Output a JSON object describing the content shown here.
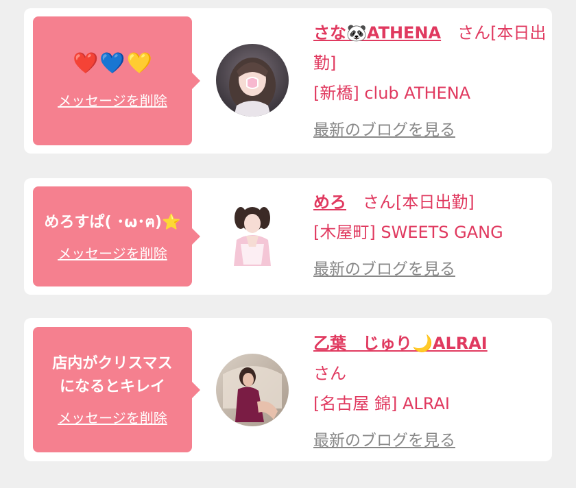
{
  "favorites": [
    {
      "hearts": [
        "❤️",
        "💙",
        "💛"
      ],
      "message": "",
      "delete_label": "メッセージを削除",
      "name": "さな🐼ATHENA",
      "san_status": "　さん[本日出勤]",
      "shop": "[新橋] club ATHENA",
      "blog_label": "最新のブログを見る"
    },
    {
      "hearts": [],
      "message": "めろすぱ( ･ω･ฅ)⭐️",
      "delete_label": "メッセージを削除",
      "name": "めろ",
      "san_status": "　さん[本日出勤]",
      "shop": "[木屋町] SWEETS GANG",
      "blog_label": "最新のブログを見る"
    },
    {
      "hearts": [],
      "message": "店内がクリスマス\nになるとキレイ",
      "delete_label": "メッセージを削除",
      "name": "乙葉　じゅり🌙ALRAI",
      "san_status": "さん",
      "shop": "[名古屋 錦] ALRAI",
      "blog_label": "最新のブログを見る"
    }
  ],
  "colors": {
    "bubble": "#f5808f",
    "accent": "#e0395f",
    "muted": "#888888",
    "page_bg": "#efefef"
  }
}
